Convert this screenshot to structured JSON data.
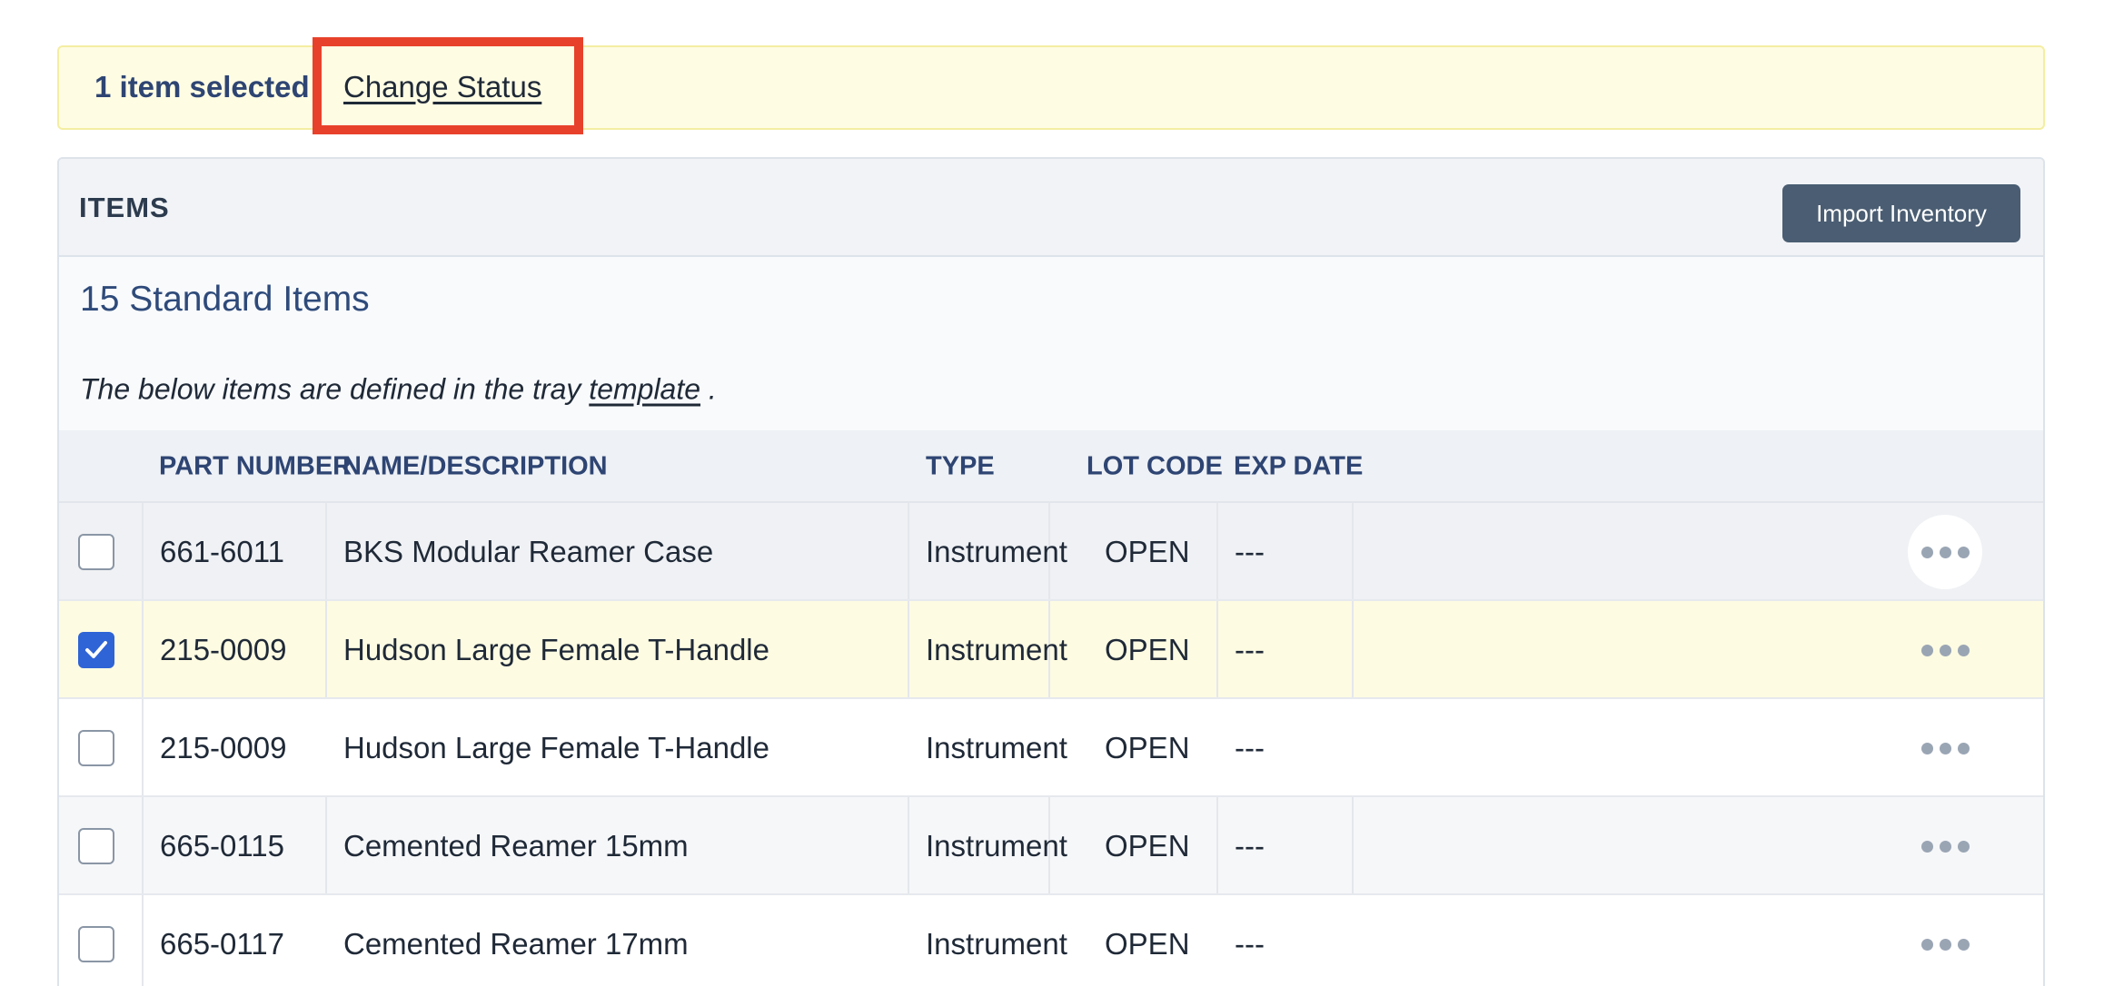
{
  "selection_bar": {
    "count_text": "1 item selected",
    "action_label": "Change Status",
    "highlight_color": "#e8412b"
  },
  "panel": {
    "title": "ITEMS",
    "import_label": "Import Inventory",
    "section_title": "15 Standard Items",
    "note_prefix": "The below items are defined in the tray",
    "note_link": "template",
    "note_suffix": "."
  },
  "table": {
    "columns": [
      "PART NUMBER",
      "NAME/DESCRIPTION",
      "TYPE",
      "LOT CODE",
      "EXP DATE"
    ],
    "rows": [
      {
        "checked": false,
        "part": "661-6011",
        "name": "BKS Modular Reamer Case",
        "type": "Instrument",
        "lot": "OPEN",
        "exp": "---"
      },
      {
        "checked": true,
        "part": "215-0009",
        "name": "Hudson Large Female T-Handle",
        "type": "Instrument",
        "lot": "OPEN",
        "exp": "---"
      },
      {
        "checked": false,
        "part": "215-0009",
        "name": "Hudson Large Female T-Handle",
        "type": "Instrument",
        "lot": "OPEN",
        "exp": "---"
      },
      {
        "checked": false,
        "part": "665-0115",
        "name": "Cemented Reamer 15mm",
        "type": "Instrument",
        "lot": "OPEN",
        "exp": "---"
      },
      {
        "checked": false,
        "part": "665-0117",
        "name": "Cemented Reamer 17mm",
        "type": "Instrument",
        "lot": "OPEN",
        "exp": "---"
      }
    ]
  },
  "icons": {
    "more": "ellipsis-icon",
    "check": "checkmark-icon"
  },
  "colors": {
    "accent_blue": "#2f64d6",
    "heading_navy": "#2e4573",
    "selected_row": "#fdfbe2",
    "button_slate": "#4a5d72"
  }
}
